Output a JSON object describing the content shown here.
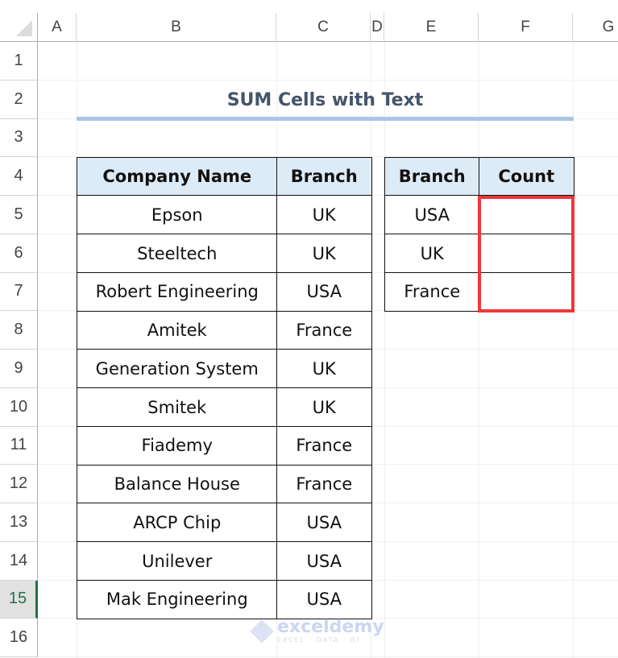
{
  "sheet": {
    "columns": [
      "A",
      "B",
      "C",
      "D",
      "E",
      "F",
      "G"
    ],
    "rows": [
      "1",
      "2",
      "3",
      "4",
      "5",
      "6",
      "7",
      "8",
      "9",
      "10",
      "11",
      "12",
      "13",
      "14",
      "15",
      "16"
    ],
    "selected_row": "15"
  },
  "title": "SUM Cells with Text",
  "main_table": {
    "headers": [
      "Company Name",
      "Branch"
    ],
    "rows": [
      [
        "Epson",
        "UK"
      ],
      [
        "Steeltech",
        "UK"
      ],
      [
        "Robert Engineering",
        "USA"
      ],
      [
        "Amitek",
        "France"
      ],
      [
        "Generation System",
        "UK"
      ],
      [
        "Smitek",
        "UK"
      ],
      [
        "Fiademy",
        "France"
      ],
      [
        "Balance House",
        "France"
      ],
      [
        "ARCP Chip",
        "USA"
      ],
      [
        "Unilever",
        "USA"
      ],
      [
        "Mak Engineering",
        "USA"
      ]
    ]
  },
  "count_table": {
    "headers": [
      "Branch",
      "Count"
    ],
    "rows": [
      [
        "USA",
        ""
      ],
      [
        "UK",
        ""
      ],
      [
        "France",
        ""
      ]
    ],
    "highlight_color": "#f0373b"
  },
  "watermark": {
    "name": "exceldemy",
    "tagline": "EXCEL · DATA · BI"
  }
}
